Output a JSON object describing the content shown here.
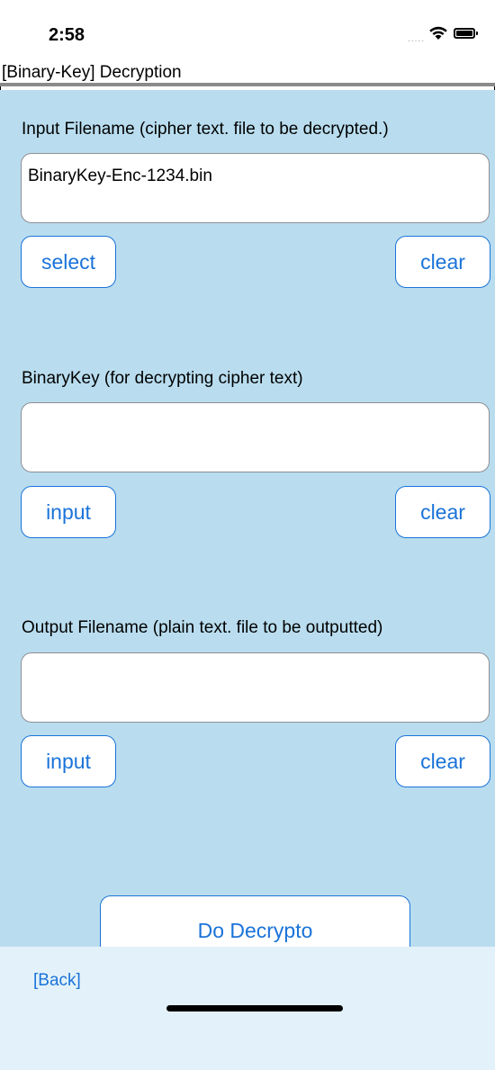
{
  "status_bar": {
    "time": "2:58",
    "signal": "....."
  },
  "nav": {
    "title": "[Binary-Key] Decryption"
  },
  "input_section": {
    "label": "Input Filename (cipher text. file to be decrypted.)",
    "value": "BinaryKey-Enc-1234.bin",
    "select_label": "select",
    "clear_label": "clear"
  },
  "key_section": {
    "label": "BinaryKey (for decrypting cipher text)",
    "value": "",
    "input_label": "input",
    "clear_label": "clear"
  },
  "output_section": {
    "label": "Output Filename (plain text. file to be outputted)",
    "value": "",
    "input_label": "input",
    "clear_label": "clear"
  },
  "actions": {
    "decrypt_label": "Do Decrypto"
  },
  "footer": {
    "back_label": "[Back]"
  },
  "colors": {
    "background": "#b9ddef",
    "accent": "#1a73d9",
    "footer": "#e3f2fa"
  }
}
